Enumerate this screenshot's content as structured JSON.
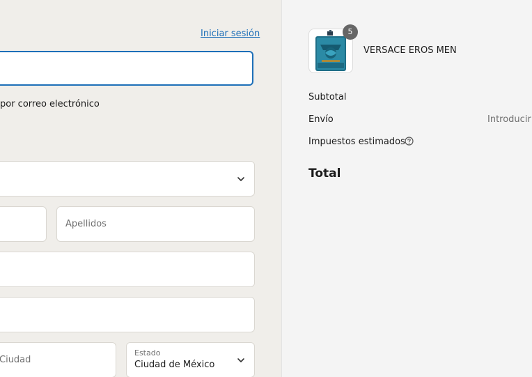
{
  "header": {
    "login_link": "Iniciar sesión"
  },
  "contact": {
    "email_value": "",
    "newsletter_label": "por correo electrónico"
  },
  "delivery": {
    "country_value": "",
    "first_name_value": "",
    "last_name_placeholder": "Apellidos",
    "address_value": "",
    "apartment_value": "",
    "city_placeholder": "Ciudad",
    "state_label": "Estado",
    "state_value": "Ciudad de México"
  },
  "summary": {
    "product": {
      "name": "VERSACE EROS MEN",
      "quantity": "5"
    },
    "subtotal_label": "Subtotal",
    "shipping_label": "Envío",
    "shipping_value": "Introducir",
    "taxes_label": "Impuestos estimados",
    "total_label": "Total"
  },
  "icons": {
    "chevron": "chevron-down-icon",
    "help": "question-circle-icon"
  },
  "colors": {
    "accent": "#1d6fb8",
    "page_bg": "#f0eeea",
    "summary_bg": "#f4f4f4"
  }
}
